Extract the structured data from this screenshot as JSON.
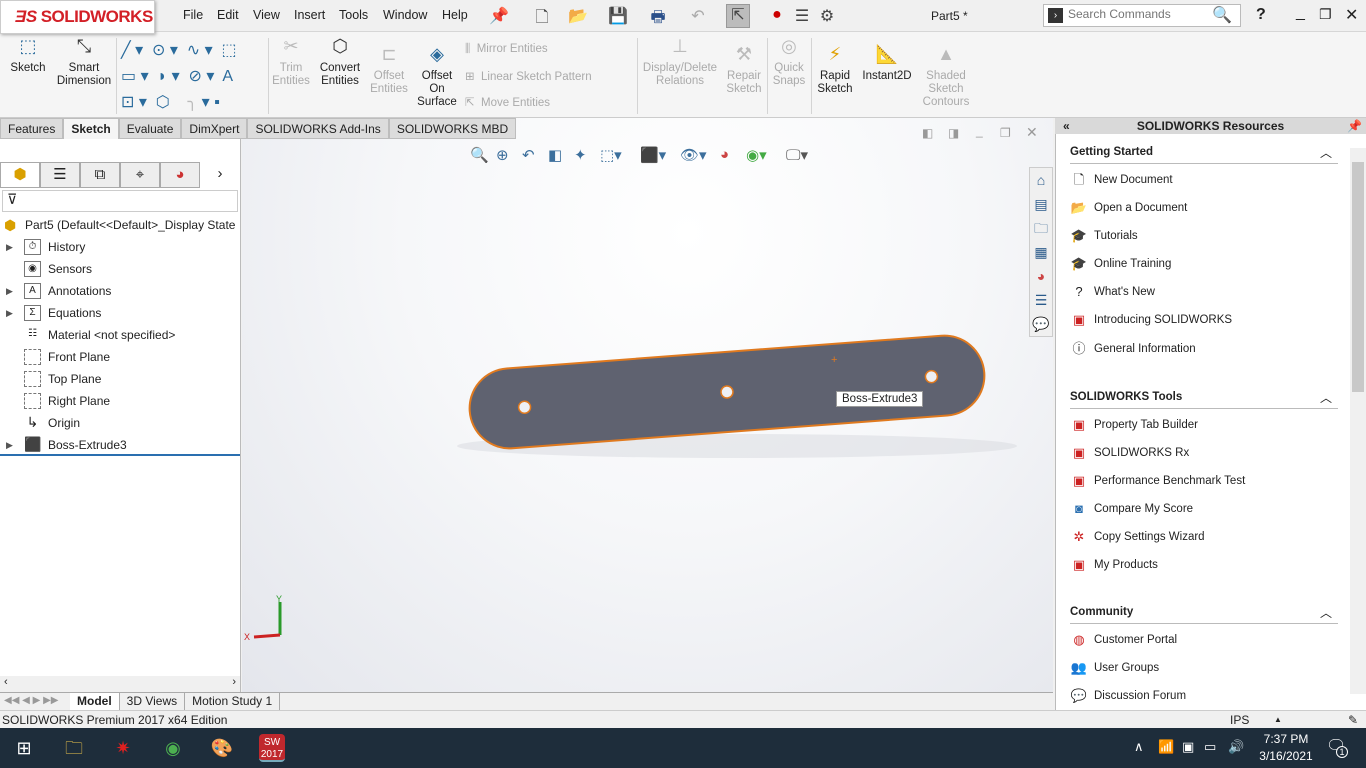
{
  "app": {
    "logo": "SOLIDWORKS",
    "document_title": "Part5 *"
  },
  "menu": [
    "File",
    "Edit",
    "View",
    "Insert",
    "Tools",
    "Window",
    "Help"
  ],
  "search": {
    "placeholder": "Search Commands"
  },
  "ribbon": {
    "sketch": "Sketch",
    "smart_dimension": "Smart Dimension",
    "trim": "Trim Entities",
    "convert": "Convert Entities",
    "offset": "Offset Entities",
    "offset_surface": "Offset On Surface",
    "mirror": "Mirror Entities",
    "linear_pattern": "Linear Sketch Pattern",
    "move": "Move Entities",
    "display_delete": "Display/Delete Relations",
    "repair": "Repair Sketch",
    "quick_snaps": "Quick Snaps",
    "rapid_sketch": "Rapid Sketch",
    "instant2d": "Instant2D",
    "shaded_contours": "Shaded Sketch Contours"
  },
  "tabs": [
    {
      "label": "Features"
    },
    {
      "label": "Sketch",
      "active": true
    },
    {
      "label": "Evaluate"
    },
    {
      "label": "DimXpert"
    },
    {
      "label": "SOLIDWORKS Add-Ins"
    },
    {
      "label": "SOLIDWORKS MBD"
    }
  ],
  "tree": {
    "root": "Part5  (Default<<Default>_Display State 1>)",
    "items": [
      {
        "label": "History",
        "expandable": true
      },
      {
        "label": "Sensors"
      },
      {
        "label": "Annotations",
        "expandable": true
      },
      {
        "label": "Equations",
        "expandable": true
      },
      {
        "label": "Material <not specified>"
      },
      {
        "label": "Front Plane"
      },
      {
        "label": "Top Plane"
      },
      {
        "label": "Right Plane"
      },
      {
        "label": "Origin"
      },
      {
        "label": "Boss-Extrude3",
        "expandable": true
      }
    ]
  },
  "viewport": {
    "tooltip": "Boss-Extrude3",
    "triad_x": "X",
    "triad_y": "Y"
  },
  "resources": {
    "title": "SOLIDWORKS Resources",
    "getting_started": {
      "title": "Getting Started",
      "items": [
        "New Document",
        "Open a Document",
        "Tutorials",
        "Online Training",
        "What's New",
        "Introducing SOLIDWORKS",
        "General Information"
      ]
    },
    "tools": {
      "title": "SOLIDWORKS Tools",
      "items": [
        "Property Tab Builder",
        "SOLIDWORKS Rx",
        "Performance Benchmark Test",
        "Compare My Score",
        "Copy Settings Wizard",
        "My Products"
      ]
    },
    "community": {
      "title": "Community",
      "items": [
        "Customer Portal",
        "User Groups",
        "Discussion Forum"
      ]
    }
  },
  "bottom_tabs": [
    {
      "label": "Model",
      "active": true
    },
    {
      "label": "3D Views"
    },
    {
      "label": "Motion Study 1"
    }
  ],
  "status": {
    "edition": "SOLIDWORKS Premium 2017 x64 Edition",
    "units": "IPS"
  },
  "taskbar": {
    "time": "7:37 PM",
    "date": "3/16/2021",
    "notifications": "1"
  },
  "colors": {
    "accent": "#d32027",
    "part_face": "#5f6270",
    "part_edge": "#e07a1f"
  }
}
